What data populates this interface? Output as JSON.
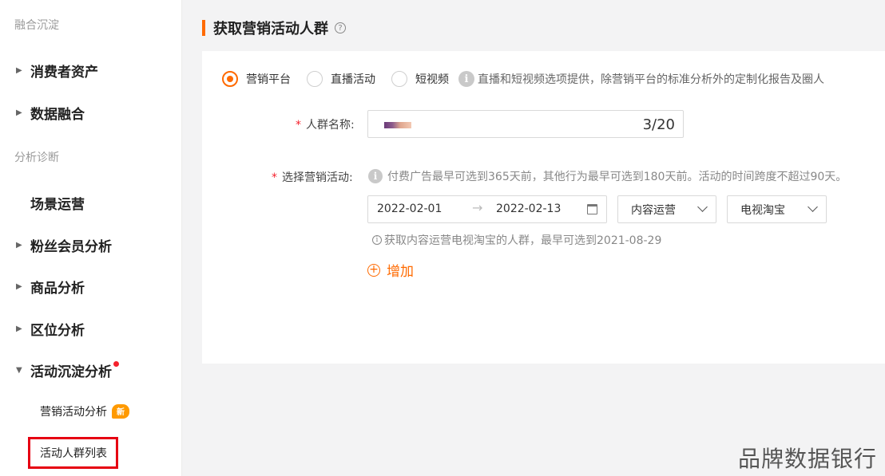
{
  "sidebar": {
    "section1": "融合沉淀",
    "section2": "分析诊断",
    "items": [
      {
        "label": "消费者资产"
      },
      {
        "label": "数据融合"
      },
      {
        "label": "场景运营"
      },
      {
        "label": "粉丝会员分析"
      },
      {
        "label": "商品分析"
      },
      {
        "label": "区位分析"
      },
      {
        "label": "活动沉淀分析"
      }
    ],
    "sub_items": [
      {
        "label": "营销活动分析",
        "badge": "新"
      },
      {
        "label": "活动人群列表"
      }
    ]
  },
  "main": {
    "title": "获取营销活动人群",
    "radios": [
      {
        "label": "营销平台",
        "checked": true
      },
      {
        "label": "直播活动",
        "checked": false
      },
      {
        "label": "短视频",
        "checked": false
      }
    ],
    "radio_info": "直播和短视频选项提供，除营销平台的标准分析外的定制化报告及圈人",
    "name_label": "人群名称:",
    "name_count": "3/20",
    "activity_label": "选择营销活动:",
    "activity_hint": "付费广告最早可选到365天前，其他行为最早可选到180天前。活动的时间跨度不超过90天。",
    "date_start": "2022-02-01",
    "date_end": "2022-02-13",
    "select1": "内容运营",
    "select2": "电视淘宝",
    "sub_hint": "获取内容运营电视淘宝的人群，最早可选到2021-08-29",
    "add_label": "增加"
  },
  "watermark": "品牌数据银行",
  "colors": {
    "accent": "#ff6a00",
    "highlight": "#e60012",
    "badge": "#ff9a00"
  }
}
